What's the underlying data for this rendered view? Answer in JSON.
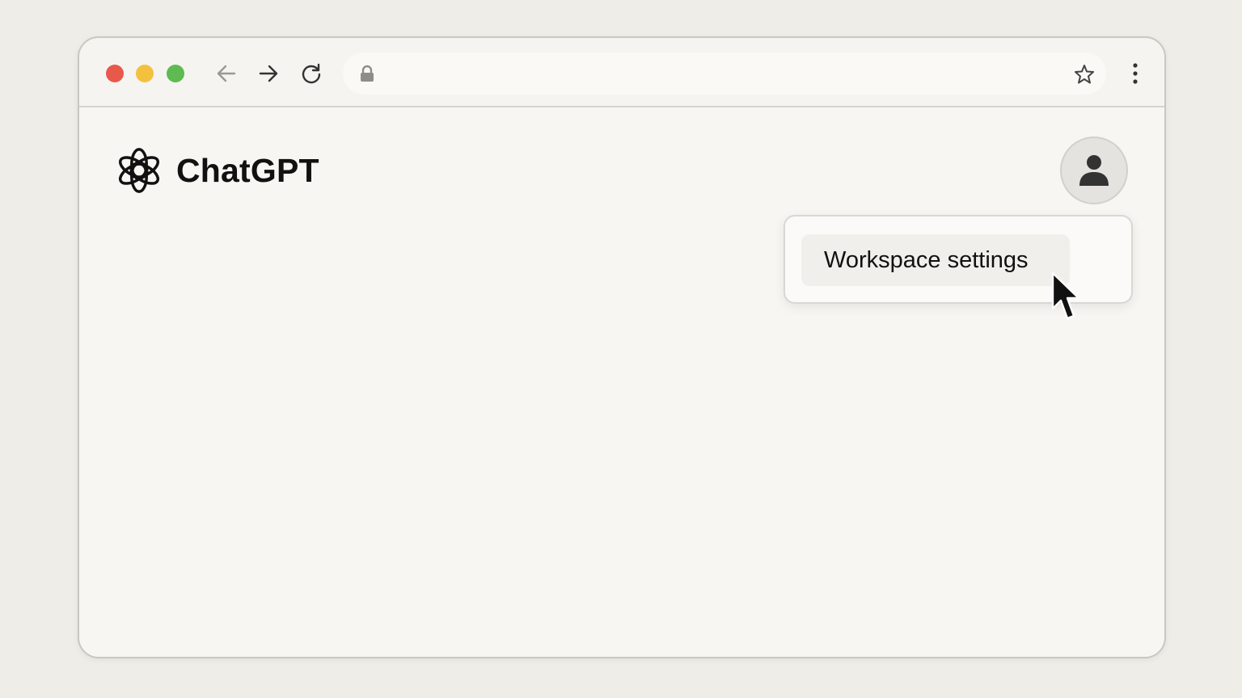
{
  "window": {
    "controls": [
      "close",
      "minimize",
      "maximize"
    ],
    "colors": {
      "close": "#e8594b",
      "minimize": "#f4c13e",
      "maximize": "#5dbb52"
    }
  },
  "toolbar": {
    "icons": [
      "arrow-left-icon",
      "arrow-right-icon",
      "reload-icon",
      "lock-icon",
      "star-icon",
      "kebab-menu-icon"
    ],
    "address": {
      "value": "",
      "placeholder": ""
    }
  },
  "app": {
    "brand_name": "ChatGPT",
    "logo_icon": "openai-logo-icon",
    "avatar_icon": "user-icon"
  },
  "menu": {
    "items": [
      {
        "label": "Workspace settings"
      }
    ]
  },
  "cursor": {
    "icon": "mouse-pointer-icon"
  }
}
